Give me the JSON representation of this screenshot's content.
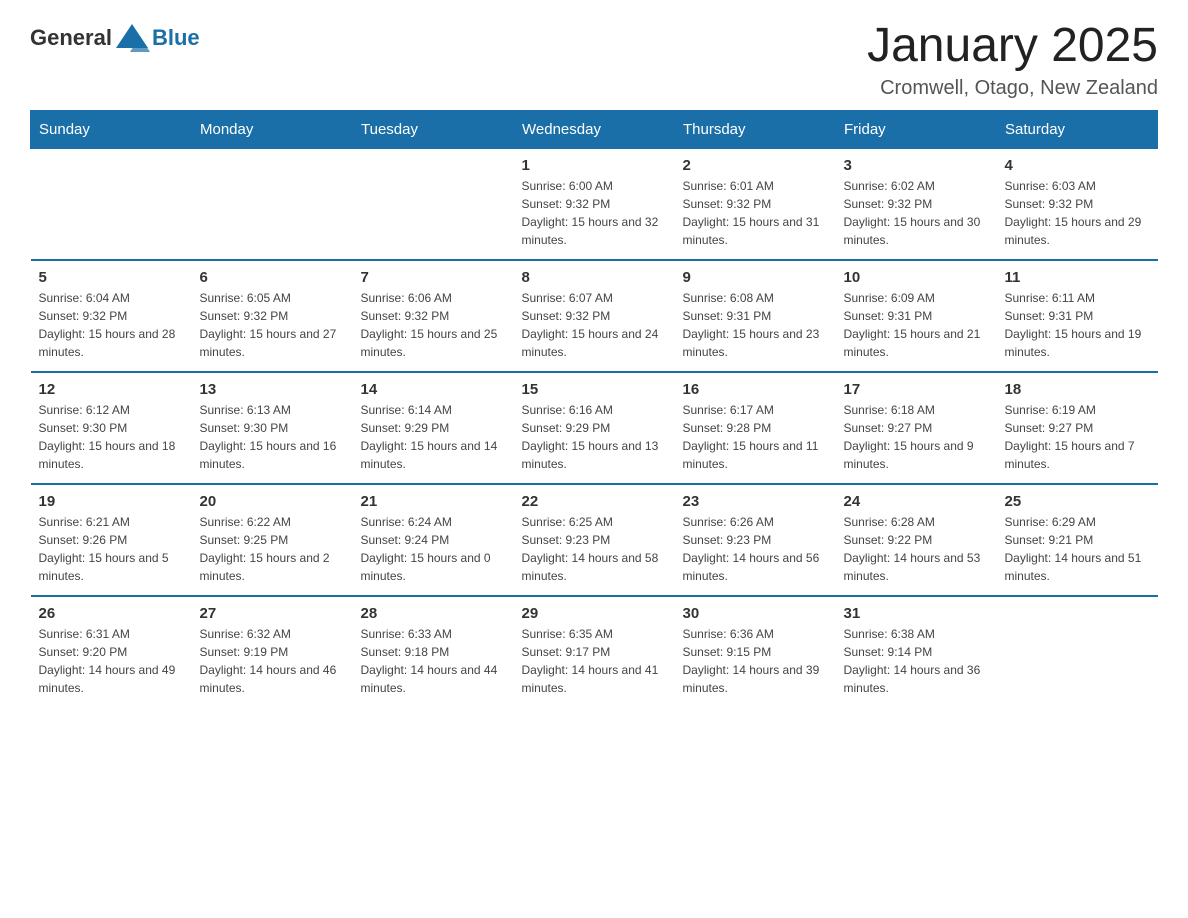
{
  "header": {
    "logo_general": "General",
    "logo_blue": "Blue",
    "title": "January 2025",
    "subtitle": "Cromwell, Otago, New Zealand"
  },
  "calendar": {
    "days_of_week": [
      "Sunday",
      "Monday",
      "Tuesday",
      "Wednesday",
      "Thursday",
      "Friday",
      "Saturday"
    ],
    "weeks": [
      [
        {
          "day": "",
          "info": ""
        },
        {
          "day": "",
          "info": ""
        },
        {
          "day": "",
          "info": ""
        },
        {
          "day": "1",
          "info": "Sunrise: 6:00 AM\nSunset: 9:32 PM\nDaylight: 15 hours and 32 minutes."
        },
        {
          "day": "2",
          "info": "Sunrise: 6:01 AM\nSunset: 9:32 PM\nDaylight: 15 hours and 31 minutes."
        },
        {
          "day": "3",
          "info": "Sunrise: 6:02 AM\nSunset: 9:32 PM\nDaylight: 15 hours and 30 minutes."
        },
        {
          "day": "4",
          "info": "Sunrise: 6:03 AM\nSunset: 9:32 PM\nDaylight: 15 hours and 29 minutes."
        }
      ],
      [
        {
          "day": "5",
          "info": "Sunrise: 6:04 AM\nSunset: 9:32 PM\nDaylight: 15 hours and 28 minutes."
        },
        {
          "day": "6",
          "info": "Sunrise: 6:05 AM\nSunset: 9:32 PM\nDaylight: 15 hours and 27 minutes."
        },
        {
          "day": "7",
          "info": "Sunrise: 6:06 AM\nSunset: 9:32 PM\nDaylight: 15 hours and 25 minutes."
        },
        {
          "day": "8",
          "info": "Sunrise: 6:07 AM\nSunset: 9:32 PM\nDaylight: 15 hours and 24 minutes."
        },
        {
          "day": "9",
          "info": "Sunrise: 6:08 AM\nSunset: 9:31 PM\nDaylight: 15 hours and 23 minutes."
        },
        {
          "day": "10",
          "info": "Sunrise: 6:09 AM\nSunset: 9:31 PM\nDaylight: 15 hours and 21 minutes."
        },
        {
          "day": "11",
          "info": "Sunrise: 6:11 AM\nSunset: 9:31 PM\nDaylight: 15 hours and 19 minutes."
        }
      ],
      [
        {
          "day": "12",
          "info": "Sunrise: 6:12 AM\nSunset: 9:30 PM\nDaylight: 15 hours and 18 minutes."
        },
        {
          "day": "13",
          "info": "Sunrise: 6:13 AM\nSunset: 9:30 PM\nDaylight: 15 hours and 16 minutes."
        },
        {
          "day": "14",
          "info": "Sunrise: 6:14 AM\nSunset: 9:29 PM\nDaylight: 15 hours and 14 minutes."
        },
        {
          "day": "15",
          "info": "Sunrise: 6:16 AM\nSunset: 9:29 PM\nDaylight: 15 hours and 13 minutes."
        },
        {
          "day": "16",
          "info": "Sunrise: 6:17 AM\nSunset: 9:28 PM\nDaylight: 15 hours and 11 minutes."
        },
        {
          "day": "17",
          "info": "Sunrise: 6:18 AM\nSunset: 9:27 PM\nDaylight: 15 hours and 9 minutes."
        },
        {
          "day": "18",
          "info": "Sunrise: 6:19 AM\nSunset: 9:27 PM\nDaylight: 15 hours and 7 minutes."
        }
      ],
      [
        {
          "day": "19",
          "info": "Sunrise: 6:21 AM\nSunset: 9:26 PM\nDaylight: 15 hours and 5 minutes."
        },
        {
          "day": "20",
          "info": "Sunrise: 6:22 AM\nSunset: 9:25 PM\nDaylight: 15 hours and 2 minutes."
        },
        {
          "day": "21",
          "info": "Sunrise: 6:24 AM\nSunset: 9:24 PM\nDaylight: 15 hours and 0 minutes."
        },
        {
          "day": "22",
          "info": "Sunrise: 6:25 AM\nSunset: 9:23 PM\nDaylight: 14 hours and 58 minutes."
        },
        {
          "day": "23",
          "info": "Sunrise: 6:26 AM\nSunset: 9:23 PM\nDaylight: 14 hours and 56 minutes."
        },
        {
          "day": "24",
          "info": "Sunrise: 6:28 AM\nSunset: 9:22 PM\nDaylight: 14 hours and 53 minutes."
        },
        {
          "day": "25",
          "info": "Sunrise: 6:29 AM\nSunset: 9:21 PM\nDaylight: 14 hours and 51 minutes."
        }
      ],
      [
        {
          "day": "26",
          "info": "Sunrise: 6:31 AM\nSunset: 9:20 PM\nDaylight: 14 hours and 49 minutes."
        },
        {
          "day": "27",
          "info": "Sunrise: 6:32 AM\nSunset: 9:19 PM\nDaylight: 14 hours and 46 minutes."
        },
        {
          "day": "28",
          "info": "Sunrise: 6:33 AM\nSunset: 9:18 PM\nDaylight: 14 hours and 44 minutes."
        },
        {
          "day": "29",
          "info": "Sunrise: 6:35 AM\nSunset: 9:17 PM\nDaylight: 14 hours and 41 minutes."
        },
        {
          "day": "30",
          "info": "Sunrise: 6:36 AM\nSunset: 9:15 PM\nDaylight: 14 hours and 39 minutes."
        },
        {
          "day": "31",
          "info": "Sunrise: 6:38 AM\nSunset: 9:14 PM\nDaylight: 14 hours and 36 minutes."
        },
        {
          "day": "",
          "info": ""
        }
      ]
    ]
  }
}
